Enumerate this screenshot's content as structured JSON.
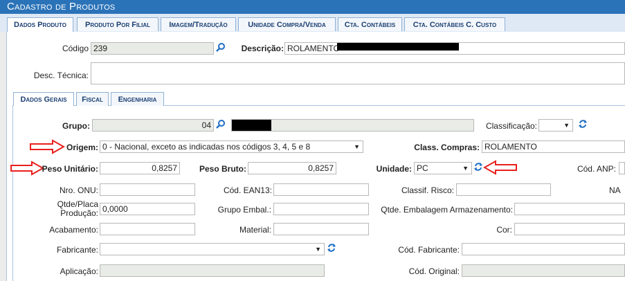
{
  "window": {
    "title": "Cadastro de Produtos"
  },
  "tabs": [
    {
      "label": "Dados Produto",
      "active": true
    },
    {
      "label": "Produto Por Filial",
      "active": false
    },
    {
      "label": "Imagem/Tradução",
      "active": false
    },
    {
      "label": "Unidade Compra/Venda",
      "active": false
    },
    {
      "label": "Cta. Contábeis",
      "active": false
    },
    {
      "label": "Cta. Contábeis C. Custo",
      "active": false
    }
  ],
  "header": {
    "codigo_label": "Código",
    "codigo_value": "239",
    "descricao_label": "Descrição:",
    "descricao_value": "ROLAMENTO",
    "desc_tecnica_label": "Desc. Técnica:",
    "desc_tecnica_value": ""
  },
  "subtabs": [
    {
      "label": "Dados Gerais",
      "active": true
    },
    {
      "label": "Fiscal",
      "active": false
    },
    {
      "label": "Engenharia",
      "active": false
    }
  ],
  "form": {
    "grupo_label": "Grupo:",
    "grupo_value": "04",
    "classificacao_label": "Classificação:",
    "classificacao_value": "",
    "origem_label": "Origem:",
    "origem_value": "0 - Nacional, exceto as indicadas nos códigos 3, 4, 5 e 8",
    "class_compras_label": "Class. Compras:",
    "class_compras_value": "ROLAMENTO",
    "peso_unitario_label": "Peso Unitário:",
    "peso_unitario_value": "0,8257",
    "peso_bruto_label": "Peso Bruto:",
    "peso_bruto_value": "0,8257",
    "unidade_label": "Unidade:",
    "unidade_value": "PC",
    "cod_anp_label": "Cód. ANP:",
    "nro_onu_label": "Nro. ONU:",
    "cod_ean13_label": "Cód. EAN13:",
    "classif_risco_label": "Classif. Risco:",
    "na_label": "NA",
    "qtde_placa_label_1": "Qtde/Placa",
    "qtde_placa_label_2": "Produção:",
    "qtde_placa_value": "0,0000",
    "grupo_embal_label": "Grupo Embal.:",
    "qtde_embalagem_label": "Qtde. Embalagem Armazenamento:",
    "acabamento_label": "Acabamento:",
    "material_label": "Material:",
    "cor_label": "Cor:",
    "fabricante_label": "Fabricante:",
    "fabricante_value": "",
    "cod_fabricante_label": "Cód. Fabricante:",
    "aplicacao_label": "Aplicação:",
    "cod_original_label": "Cód. Original:"
  },
  "icons": {
    "search": "search-icon",
    "refresh": "refresh-icon",
    "dropdown": "chevron-down-icon",
    "annotation_arrow": "red-arrow-annotation"
  },
  "colors": {
    "title_bar": "#2b73b8",
    "tab_text": "#1c3f73",
    "readonly_field": "#e9ece6",
    "annotation": "#e8201c",
    "icon": "#1f6fc4"
  }
}
